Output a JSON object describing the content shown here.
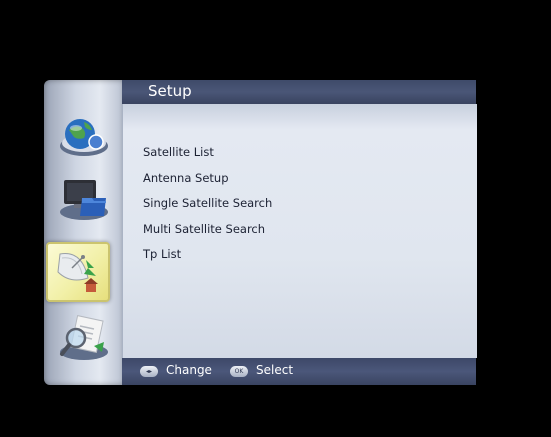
{
  "header": {
    "title": "Setup"
  },
  "sidebar": {
    "items": [
      {
        "icon": "globe-icon",
        "selected": false
      },
      {
        "icon": "computer-folder-icon",
        "selected": false
      },
      {
        "icon": "satellite-dish-icon",
        "selected": true
      },
      {
        "icon": "magnifier-document-icon",
        "selected": false
      }
    ]
  },
  "menu": {
    "items": [
      {
        "label": "Satellite List"
      },
      {
        "label": "Antenna Setup"
      },
      {
        "label": "Single Satellite Search"
      },
      {
        "label": "Multi Satellite Search"
      },
      {
        "label": "Tp List"
      }
    ]
  },
  "footer": {
    "change_key": "◂▸",
    "change_label": "Change",
    "select_key": "OK",
    "select_label": "Select"
  },
  "colors": {
    "header_bg": "#434f6f",
    "panel_bg": "#e0e6ef",
    "text": "#1c2133",
    "selected_icon_bg": "#f2f0a8"
  }
}
